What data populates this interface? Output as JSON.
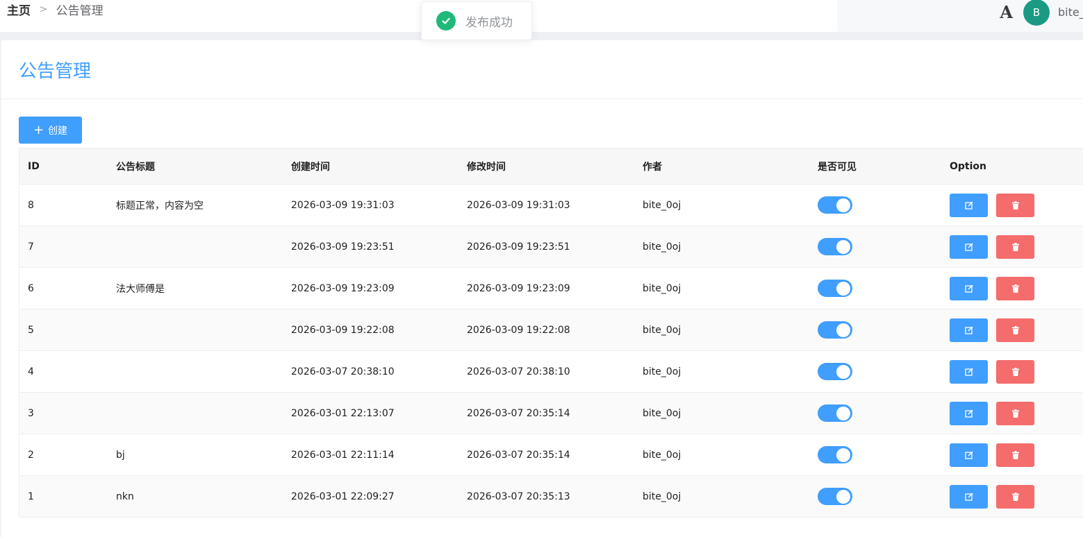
{
  "breadcrumb": {
    "home": "主页",
    "current": "公告管理"
  },
  "header": {
    "font_icon": "A",
    "avatar_letter": "B",
    "username": "bite_"
  },
  "toast": {
    "text": "发布成功",
    "icon": "check-circle-icon",
    "color": "#1fb97a"
  },
  "page": {
    "title": "公告管理",
    "create_label": "创建"
  },
  "colors": {
    "primary": "#409eff",
    "danger": "#f56c6c"
  },
  "table": {
    "columns": [
      "ID",
      "公告标题",
      "创建时间",
      "修改时间",
      "作者",
      "是否可见",
      "Option"
    ],
    "rows": [
      {
        "id": "8",
        "title": "标题正常，内容为空",
        "created": "2026-03-09 19:31:03",
        "updated": "2026-03-09 19:31:03",
        "author": "bite_0oj",
        "visible": true
      },
      {
        "id": "7",
        "title": "",
        "created": "2026-03-09 19:23:51",
        "updated": "2026-03-09 19:23:51",
        "author": "bite_0oj",
        "visible": true
      },
      {
        "id": "6",
        "title": "法大师傅是",
        "created": "2026-03-09 19:23:09",
        "updated": "2026-03-09 19:23:09",
        "author": "bite_0oj",
        "visible": true
      },
      {
        "id": "5",
        "title": "",
        "created": "2026-03-09 19:22:08",
        "updated": "2026-03-09 19:22:08",
        "author": "bite_0oj",
        "visible": true
      },
      {
        "id": "4",
        "title": "",
        "created": "2026-03-07 20:38:10",
        "updated": "2026-03-07 20:38:10",
        "author": "bite_0oj",
        "visible": true
      },
      {
        "id": "3",
        "title": "",
        "created": "2026-03-01 22:13:07",
        "updated": "2026-03-07 20:35:14",
        "author": "bite_0oj",
        "visible": true
      },
      {
        "id": "2",
        "title": "bj",
        "created": "2026-03-01 22:11:14",
        "updated": "2026-03-07 20:35:14",
        "author": "bite_0oj",
        "visible": true
      },
      {
        "id": "1",
        "title": "nkn",
        "created": "2026-03-01 22:09:27",
        "updated": "2026-03-07 20:35:13",
        "author": "bite_0oj",
        "visible": true
      }
    ]
  }
}
